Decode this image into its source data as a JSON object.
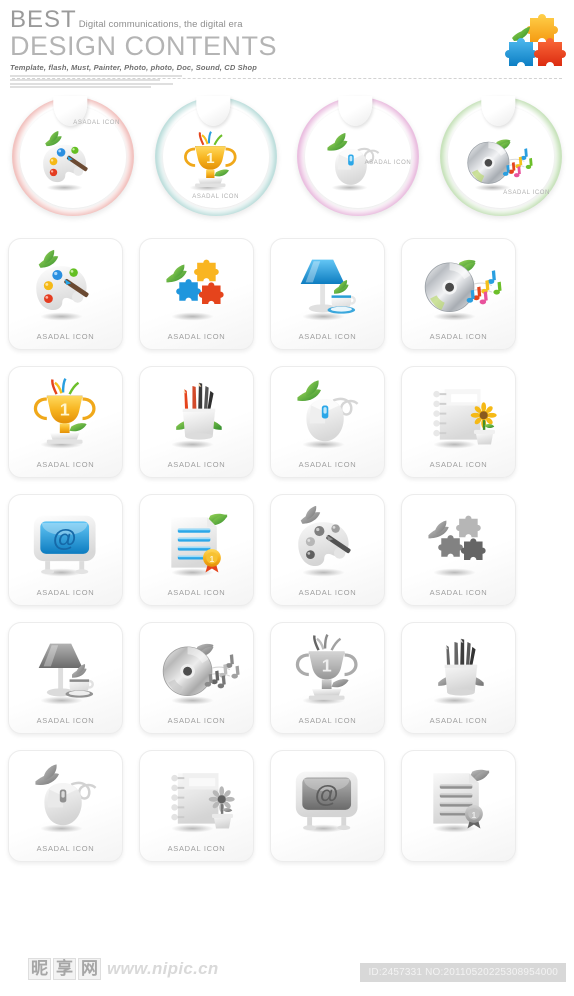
{
  "header": {
    "best": "BEST",
    "tagline": "Digital communications, the digital era",
    "title": "DESIGN CONTENTS",
    "subtitle": "Template, flash, Must, Painter, Photo, photo, Doc, Sound, CD Shop",
    "logo_icon": "puzzle-logo-icon"
  },
  "stickers": [
    {
      "label": "ASADAL ICON",
      "ring_color": "#f2c3c0",
      "icon": "palette-icon",
      "label_pos": "top-right"
    },
    {
      "label": "ASADAL ICON",
      "ring_color": "#bfdfdd",
      "icon": "trophy-icon",
      "label_pos": "bottom-center"
    },
    {
      "label": "ASADAL ICON",
      "ring_color": "#eabfe0",
      "icon": "mouse-icon",
      "label_pos": "mid-right"
    },
    {
      "label": "ASADAL ICON",
      "ring_color": "#c9e3bd",
      "icon": "cd-music-icon",
      "label_pos": "bottom-right"
    }
  ],
  "tiles": [
    {
      "label": "ASADAL ICON",
      "icon": "palette-icon",
      "gray": false
    },
    {
      "label": "ASADAL ICON",
      "icon": "puzzle-icon",
      "gray": false
    },
    {
      "label": "ASADAL ICON",
      "icon": "lamp-cup-icon",
      "gray": false
    },
    {
      "label": "ASADAL ICON",
      "icon": "cd-music-icon",
      "gray": false
    },
    {
      "label": "ASADAL ICON",
      "icon": "trophy-icon",
      "gray": false
    },
    {
      "label": "ASADAL ICON",
      "icon": "pencil-cup-icon",
      "gray": false
    },
    {
      "label": "ASADAL ICON",
      "icon": "mouse-icon",
      "gray": false
    },
    {
      "label": "ASADAL ICON",
      "icon": "notebook-flower-icon",
      "gray": false
    },
    {
      "label": "ASADAL ICON",
      "icon": "monitor-at-icon",
      "gray": false
    },
    {
      "label": "ASADAL ICON",
      "icon": "document-medal-icon",
      "gray": false
    },
    {
      "label": "ASADAL ICON",
      "icon": "palette-icon",
      "gray": true
    },
    {
      "label": "ASADAL ICON",
      "icon": "puzzle-icon",
      "gray": true
    },
    {
      "label": "ASADAL ICON",
      "icon": "lamp-cup-icon",
      "gray": true
    },
    {
      "label": "ASADAL ICON",
      "icon": "cd-music-icon",
      "gray": true
    },
    {
      "label": "ASADAL ICON",
      "icon": "trophy-icon",
      "gray": true
    },
    {
      "label": "ASADAL ICON",
      "icon": "pencil-cup-icon",
      "gray": true
    },
    {
      "label": "ASADAL ICON",
      "icon": "mouse-icon",
      "gray": true
    },
    {
      "label": "ASADAL ICON",
      "icon": "notebook-flower-icon",
      "gray": true
    },
    {
      "label": "",
      "icon": "monitor-at-icon",
      "gray": true
    },
    {
      "label": "",
      "icon": "document-medal-icon",
      "gray": true
    }
  ],
  "footer": {
    "watermark_chars": [
      "昵",
      "享",
      "网"
    ],
    "watermark_url": "www.nipic.cn",
    "id_text": "ID:2457331 NO:20110520225308954000"
  },
  "colors": {
    "title_gray": "#b4b4b4",
    "label_gray": "#9e9e9e",
    "idbar_bg": "#d8d8d8"
  }
}
